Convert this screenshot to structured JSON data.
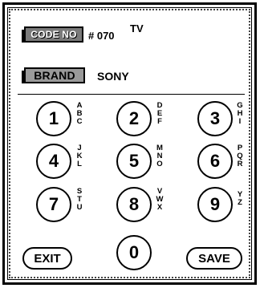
{
  "header": {
    "code_label": "CODE NO",
    "code_value": "# 070",
    "device_type": "TV",
    "brand_label": "BRAND",
    "brand_value": "SONY"
  },
  "keys": [
    {
      "digit": "1",
      "letters": [
        "A",
        "B",
        "C"
      ]
    },
    {
      "digit": "2",
      "letters": [
        "D",
        "E",
        "F"
      ]
    },
    {
      "digit": "3",
      "letters": [
        "G",
        "H",
        "I"
      ]
    },
    {
      "digit": "4",
      "letters": [
        "J",
        "K",
        "L"
      ]
    },
    {
      "digit": "5",
      "letters": [
        "M",
        "N",
        "O"
      ]
    },
    {
      "digit": "6",
      "letters": [
        "P",
        "Q",
        "R"
      ]
    },
    {
      "digit": "7",
      "letters": [
        "S",
        "T",
        "U"
      ]
    },
    {
      "digit": "8",
      "letters": [
        "V",
        "W",
        "X"
      ]
    },
    {
      "digit": "9",
      "letters": [
        "Y",
        "Z"
      ]
    },
    {
      "digit": "0",
      "letters": []
    }
  ],
  "actions": {
    "exit_label": "EXIT",
    "save_label": "SAVE"
  }
}
